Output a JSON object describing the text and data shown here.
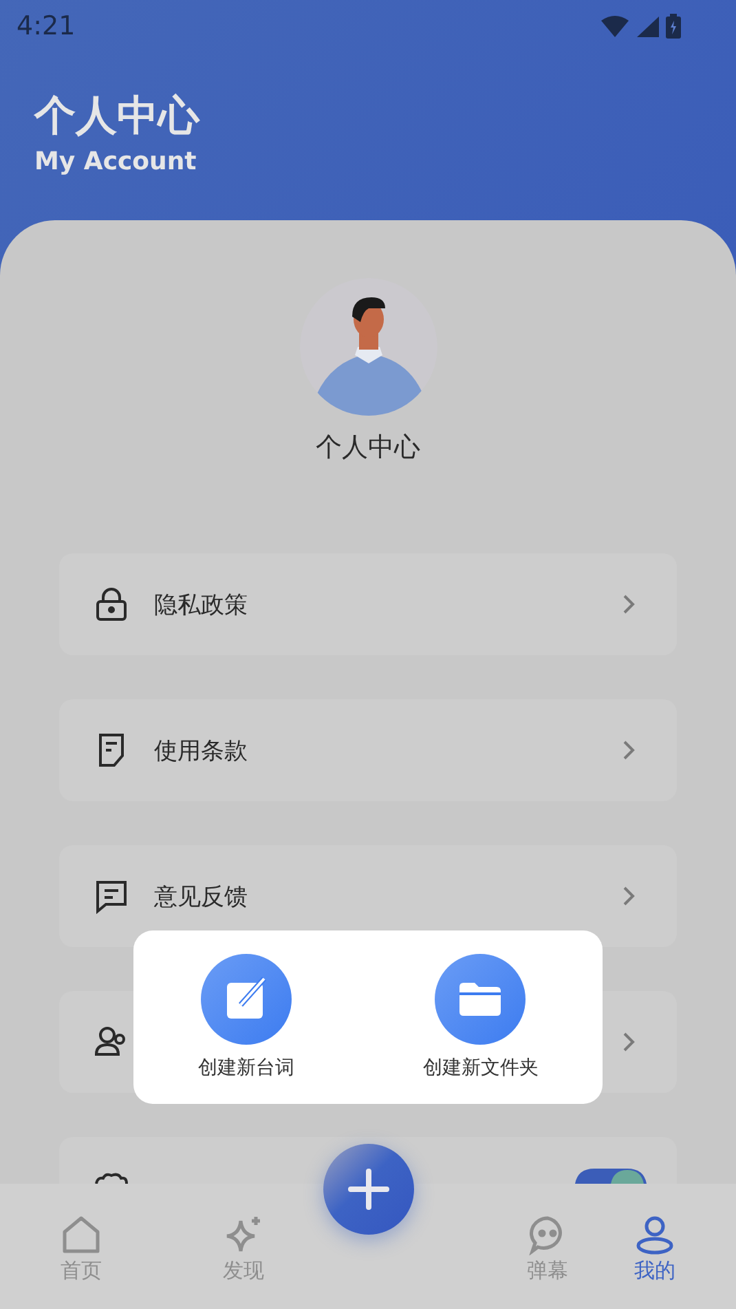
{
  "status_bar": {
    "time": "4:21"
  },
  "header": {
    "title": "个人中心",
    "subtitle": "My Account"
  },
  "profile": {
    "name": "个人中心"
  },
  "menu": [
    {
      "kind": "link",
      "label": "隐私政策"
    },
    {
      "kind": "link",
      "label": "使用条款"
    },
    {
      "kind": "link",
      "label": "意见反馈"
    },
    {
      "kind": "link"
    },
    {
      "kind": "toggle",
      "on": true
    }
  ],
  "popup": {
    "actions": [
      {
        "label": "创建新台词"
      },
      {
        "label": "创建新文件夹"
      }
    ]
  },
  "bottom_nav": [
    {
      "label": "首页",
      "selected": false
    },
    {
      "label": "发现",
      "selected": false
    },
    {
      "label": "弹幕",
      "selected": false
    },
    {
      "label": "我的",
      "selected": true
    }
  ]
}
